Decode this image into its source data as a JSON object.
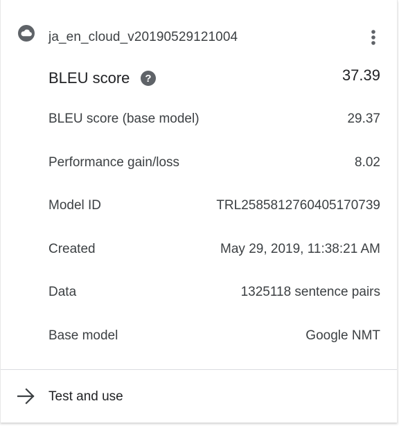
{
  "header": {
    "model_name": "ja_en_cloud_v20190529121004",
    "cloud_icon": "cloud-icon",
    "more_icon": "more-vert-icon"
  },
  "bleu": {
    "label": "BLEU score",
    "value": "37.39",
    "help_icon": "help-icon"
  },
  "details": [
    {
      "label": "BLEU score (base model)",
      "value": "29.37"
    },
    {
      "label": "Performance gain/loss",
      "value": "8.02"
    },
    {
      "label": "Model ID",
      "value": "TRL2585812760405170739"
    },
    {
      "label": "Created",
      "value": "May 29, 2019, 11:38:21 AM"
    },
    {
      "label": "Data",
      "value": "1325118 sentence pairs"
    },
    {
      "label": "Base model",
      "value": "Google NMT"
    }
  ],
  "action": {
    "label": "Test and use",
    "icon": "arrow-forward-icon"
  },
  "colors": {
    "icon_gray": "#5f6368",
    "text_primary": "#202124",
    "text_secondary": "#3c4043",
    "divider": "#dadce0"
  }
}
